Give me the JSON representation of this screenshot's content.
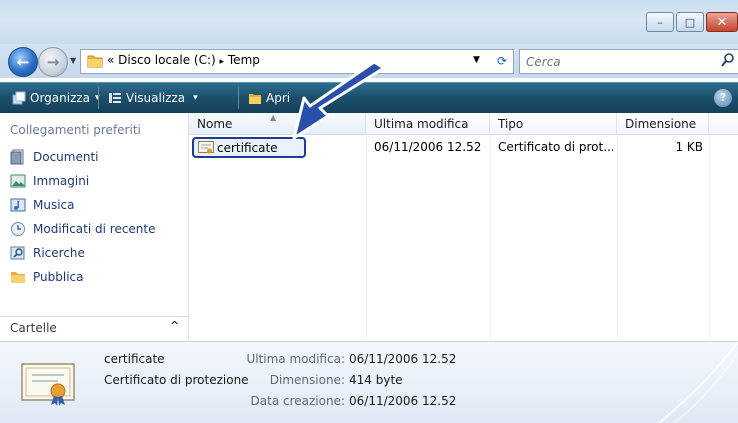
{
  "window": {
    "buttons": {
      "minimize": "–",
      "maximize": "□",
      "close": "✕"
    }
  },
  "address": {
    "prefix": "«",
    "path": [
      "Disco locale (C:)",
      "Temp"
    ],
    "separator": "▸",
    "search_placeholder": "Cerca"
  },
  "toolbar": {
    "organize": "Organizza",
    "view": "Visualizza",
    "open": "Apri",
    "dropdown": "▾",
    "help": "?"
  },
  "nav": {
    "header": "Collegamenti preferiti",
    "items": [
      {
        "label": "Documenti",
        "icon": "documents-icon",
        "color": "#5b6f86"
      },
      {
        "label": "Immagini",
        "icon": "pictures-icon",
        "color": "#3f8a6a"
      },
      {
        "label": "Musica",
        "icon": "music-icon",
        "color": "#3d6fb0"
      },
      {
        "label": "Modificati di recente",
        "icon": "recent-icon",
        "color": "#6f8fb5"
      },
      {
        "label": "Ricerche",
        "icon": "searches-icon",
        "color": "#5a7fa8"
      },
      {
        "label": "Pubblica",
        "icon": "public-folder-icon",
        "color": "#e0b03a"
      }
    ],
    "folders_label": "Cartelle",
    "folders_toggle": "^"
  },
  "list": {
    "columns": [
      "Nome",
      "Ultima modifica",
      "Tipo",
      "Dimensione"
    ],
    "rows": [
      {
        "name": "certificate",
        "modified": "06/11/2006 12.52",
        "type": "Certificato di prot...",
        "size": "1 KB"
      }
    ]
  },
  "details": {
    "name": "certificate",
    "type": "Certificato di protezione",
    "modified_label": "Ultima modifica:",
    "modified_value": "06/11/2006 12.52",
    "size_label": "Dimensione:",
    "size_value": "414 byte",
    "created_label": "Data creazione:",
    "created_value": "06/11/2006 12.52"
  },
  "colors": {
    "toolbar": "#1c4e6b",
    "accent_arrow": "#2a4fa8",
    "selection_border": "#1e3d8f",
    "nav_text": "#1e3a73"
  }
}
